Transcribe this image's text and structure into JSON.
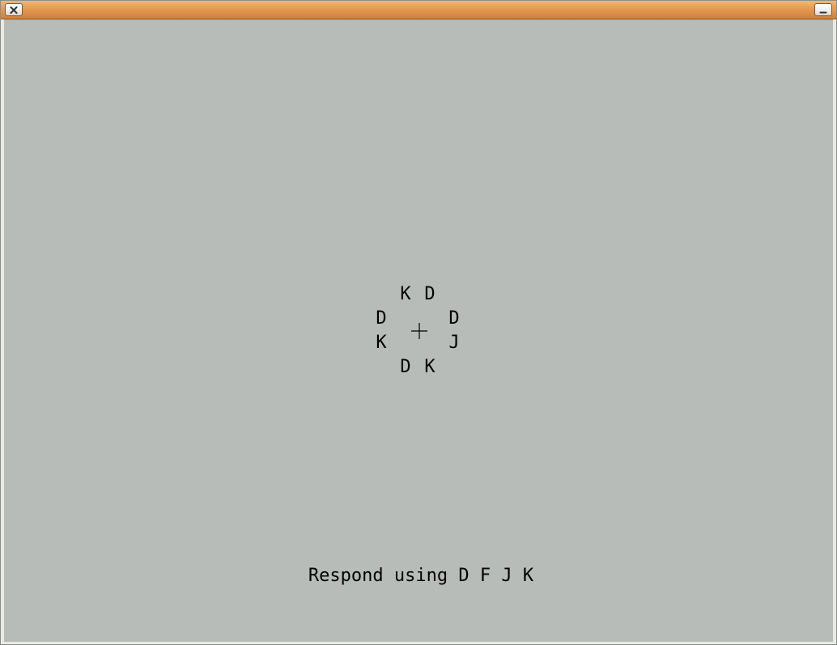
{
  "window": {
    "close_icon": "close-icon",
    "minimize_icon": "minimize-icon",
    "titlebar_color": "#e49a52"
  },
  "stimulus": {
    "letters": [
      "K",
      "D",
      "D",
      "D",
      "K",
      "J",
      "D",
      "K"
    ],
    "fixation_icon": "plus-icon"
  },
  "instruction": "Respond using D F J K",
  "colors": {
    "background": "#b8bcb8",
    "text": "#000000"
  }
}
